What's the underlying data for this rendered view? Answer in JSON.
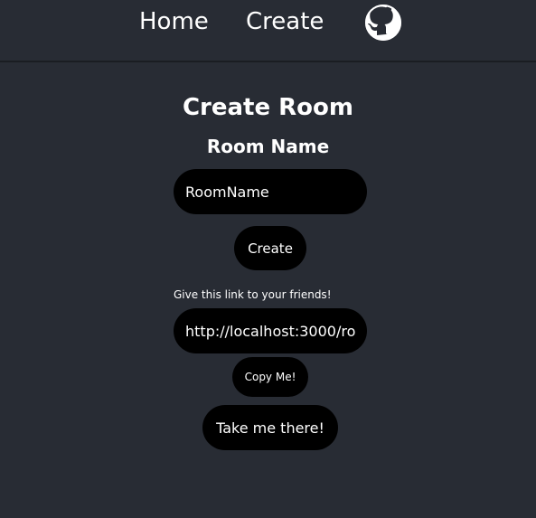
{
  "nav": {
    "home_label": "Home",
    "create_label": "Create",
    "github_icon": "github-icon"
  },
  "main": {
    "title": "Create Room",
    "room_name_heading": "Room Name",
    "room_input": {
      "value": "",
      "placeholder": "RoomName"
    },
    "create_button_label": "Create",
    "share_hint": "Give this link to your friends!",
    "share_link_value": "http://localhost:3000/ro",
    "copy_button_label": "Copy Me!",
    "go_button_label": "Take me there!"
  },
  "colors": {
    "background": "#282c34",
    "pill": "#000000",
    "text": "#ffffff"
  }
}
